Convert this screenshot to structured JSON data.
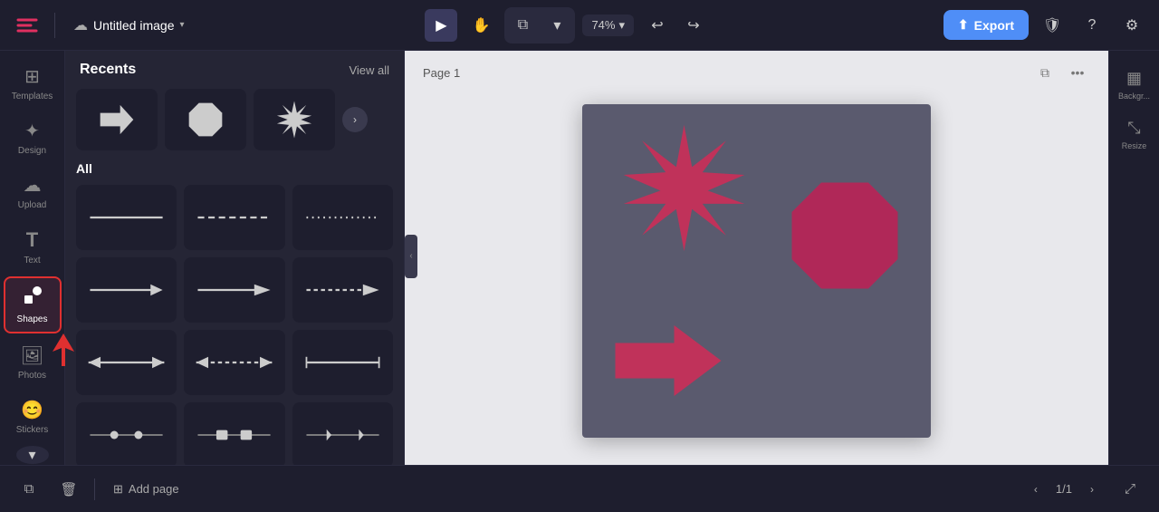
{
  "topbar": {
    "title": "Untitled image",
    "zoom": "74%",
    "export_label": "Export",
    "page_label": "Page 1"
  },
  "sidebar": {
    "items": [
      {
        "id": "templates",
        "label": "Templates",
        "icon": "⊞"
      },
      {
        "id": "design",
        "label": "Design",
        "icon": "✦"
      },
      {
        "id": "upload",
        "label": "Upload",
        "icon": "☁"
      },
      {
        "id": "text",
        "label": "Text",
        "icon": "T"
      },
      {
        "id": "shapes",
        "label": "Shapes",
        "icon": "⬡",
        "active": true
      },
      {
        "id": "photos",
        "label": "Photos",
        "icon": "🖼"
      },
      {
        "id": "stickers",
        "label": "Stickers",
        "icon": "😊"
      }
    ]
  },
  "panel": {
    "recents_title": "Recents",
    "view_all": "View all",
    "all_title": "All"
  },
  "bottom": {
    "add_page": "Add page",
    "page_info": "1/1"
  },
  "right_panel": {
    "items": [
      {
        "label": "Backgr...",
        "icon": "▦"
      },
      {
        "label": "Resize",
        "icon": "⤡"
      }
    ]
  }
}
